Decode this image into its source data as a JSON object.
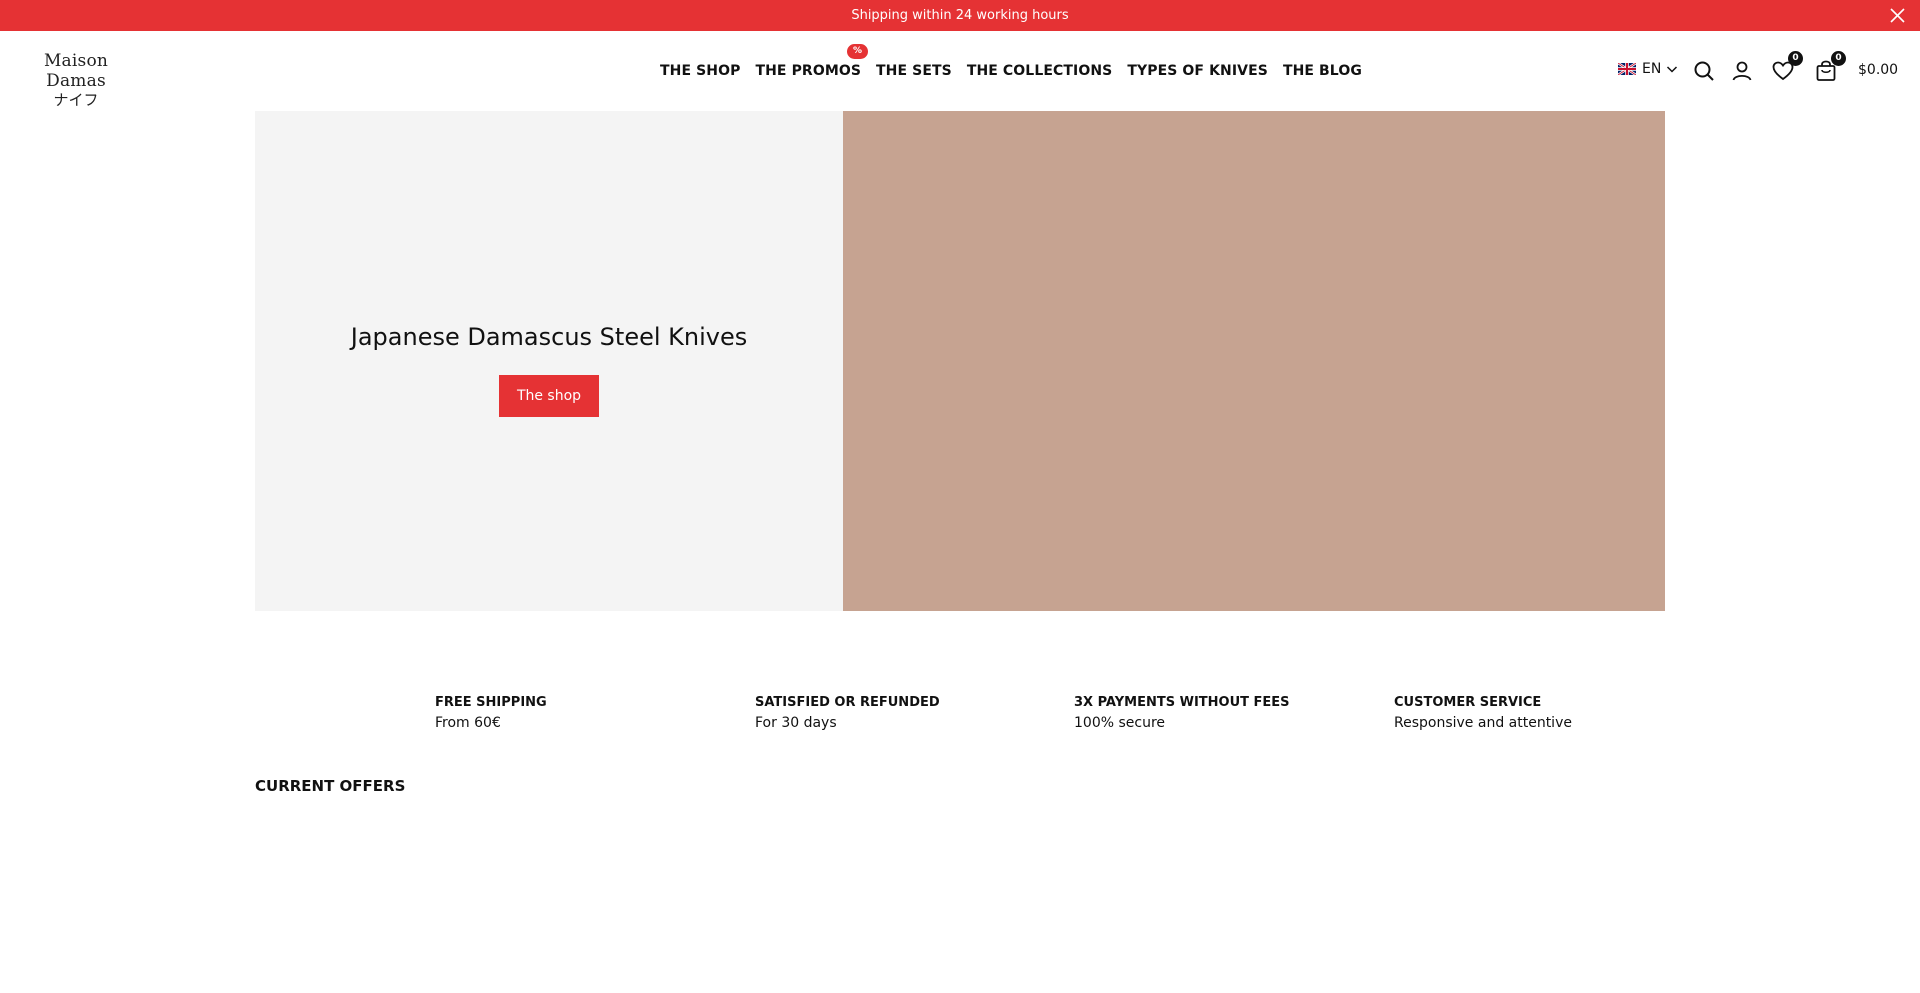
{
  "announcement": {
    "text": "Shipping within 24 working hours",
    "close_icon": "close-icon"
  },
  "header": {
    "logo": {
      "line1": "Maison Damas",
      "line2": "ナイフ"
    },
    "nav": [
      {
        "label": "THE SHOP"
      },
      {
        "label": "THE PROMOS",
        "badge": "%"
      },
      {
        "label": "THE SETS"
      },
      {
        "label": "THE COLLECTIONS"
      },
      {
        "label": "TYPES OF KNIVES"
      },
      {
        "label": "THE BLOG"
      }
    ],
    "language": {
      "code": "EN",
      "flag_icon": "uk-flag-icon"
    },
    "wishlist_count": "0",
    "cart_count": "0",
    "cart_total": "$0.00"
  },
  "hero": {
    "title": "Japanese Damascus Steel Knives",
    "button_label": "The shop",
    "image_placeholder_color": "#c6a391"
  },
  "features": [
    {
      "title": "FREE SHIPPING",
      "subtitle": "From 60€"
    },
    {
      "title": "SATISFIED OR REFUNDED",
      "subtitle": "For 30 days"
    },
    {
      "title": "3X PAYMENTS WITHOUT FEES",
      "subtitle": "100% secure"
    },
    {
      "title": "CUSTOMER SERVICE",
      "subtitle": "Responsive and attentive"
    }
  ],
  "offers": {
    "title": "CURRENT OFFERS"
  },
  "colors": {
    "accent": "#e53234",
    "hero_left_bg": "#f4f4f4",
    "text": "#111111"
  }
}
